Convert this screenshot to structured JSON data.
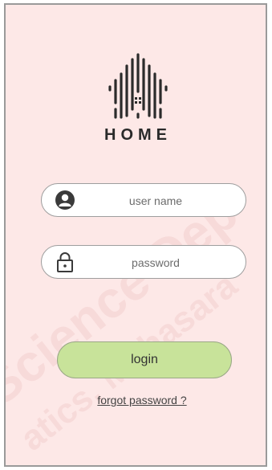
{
  "logo": {
    "text": "HOME"
  },
  "username": {
    "placeholder": "user name"
  },
  "password": {
    "placeholder": "password"
  },
  "actions": {
    "login_label": "login",
    "forgot_label": "forgot password ?"
  },
  "colors": {
    "background": "#fde8e7",
    "login_button": "#c8e39a"
  }
}
